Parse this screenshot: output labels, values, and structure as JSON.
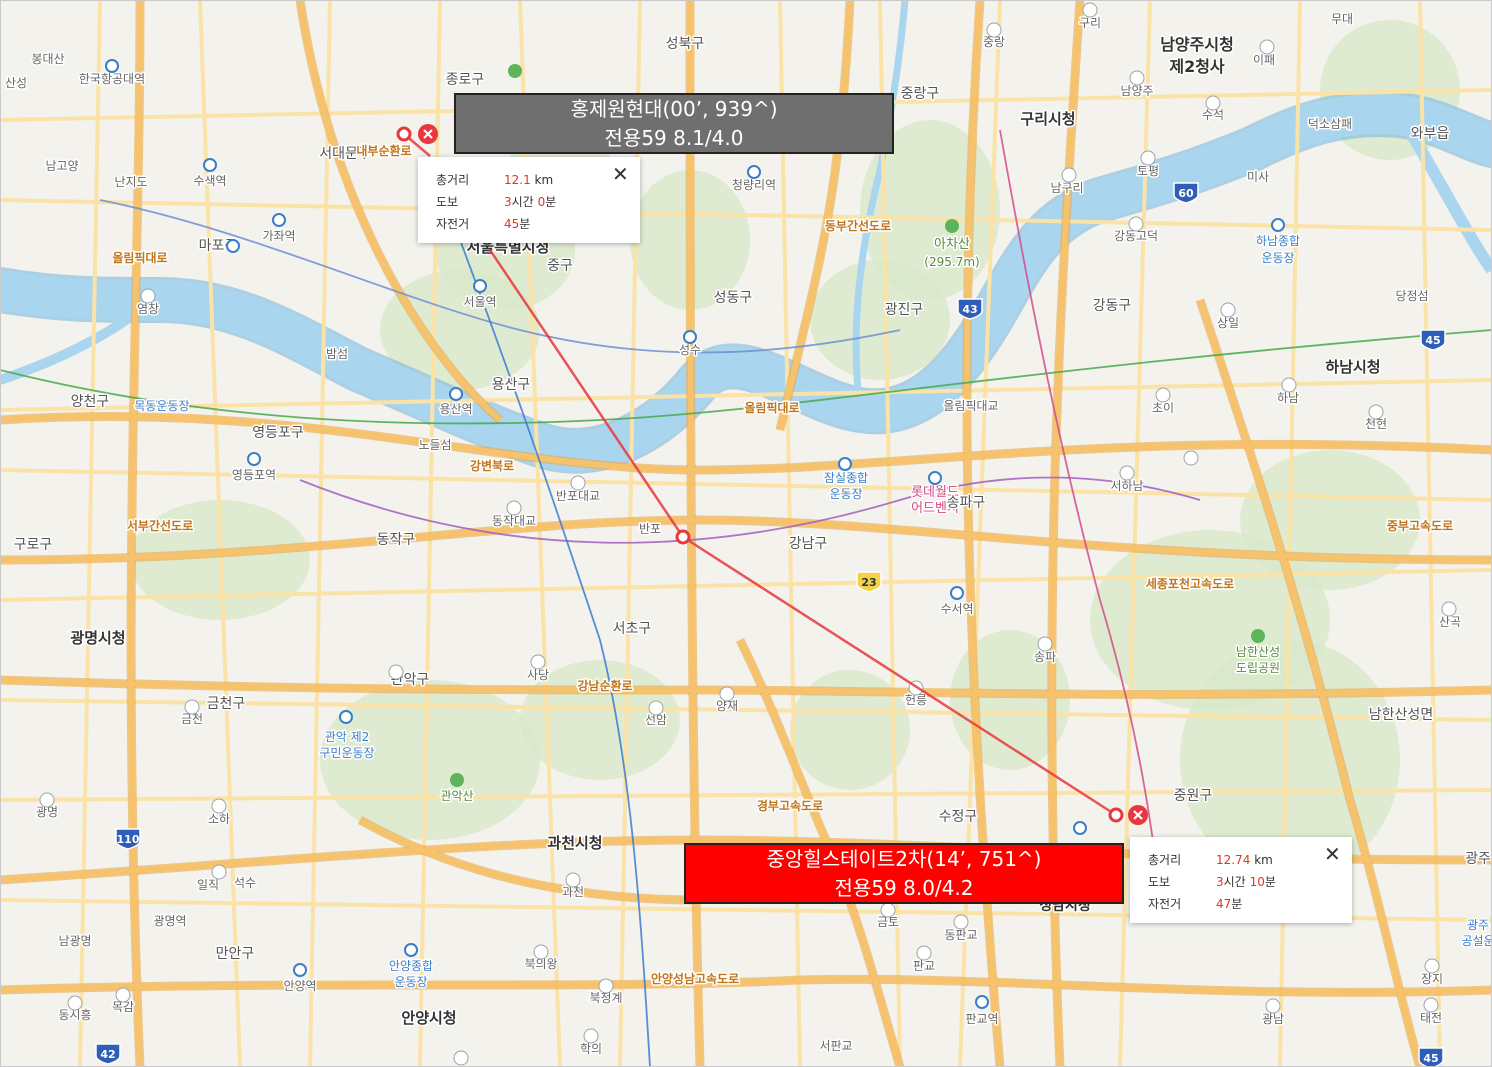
{
  "colors": {
    "land": "#f3f2ec",
    "river": "#a9d5ef",
    "river_edge": "#7fb8de",
    "park": "#d8e8c8",
    "road_main": "#f6c26b",
    "road_minor": "#fbe3a7",
    "measure_line": "#e8383d",
    "box_gray": "#6f6f6f",
    "box_red": "#ff0000"
  },
  "measurements": [
    {
      "title_line1": "홍제원현대(00’, 939^)",
      "title_line2": "전용59 8.1/4.0",
      "box_style": "gray",
      "total_label": "총거리",
      "total_value": "12.1",
      "total_unit": "km",
      "walk_label": "도보",
      "walk_h": "3",
      "walk_h_unit": "시간",
      "walk_m": "0",
      "walk_m_unit": "분",
      "bike_label": "자전거",
      "bike_m": "45",
      "bike_m_unit": "분"
    },
    {
      "title_line1": "중앙힐스테이트2차(14’, 751^)",
      "title_line2": "전용59 8.0/4.2",
      "box_style": "red",
      "total_label": "총거리",
      "total_value": "12.74",
      "total_unit": "km",
      "walk_label": "도보",
      "walk_h": "3",
      "walk_h_unit": "시간",
      "walk_m": "10",
      "walk_m_unit": "분",
      "bike_label": "자전거",
      "bike_m": "47",
      "bike_m_unit": "분"
    }
  ],
  "map_labels": [
    {
      "text": "성북구",
      "cls": "district"
    },
    {
      "text": "종로구",
      "cls": "district"
    },
    {
      "text": "서대문구",
      "cls": "district"
    },
    {
      "text": "중랑구",
      "cls": "district"
    },
    {
      "text": "구리시청",
      "cls": "city"
    },
    {
      "text": "남양주시청",
      "cls": "city"
    },
    {
      "text": "제2청사",
      "cls": "city"
    },
    {
      "text": "와부읍",
      "cls": "district"
    },
    {
      "text": "덕소삼패",
      "cls": "small"
    },
    {
      "text": "이패",
      "cls": "small"
    },
    {
      "text": "무대",
      "cls": "small"
    },
    {
      "text": "남구리",
      "cls": "small"
    },
    {
      "text": "토평",
      "cls": "small"
    },
    {
      "text": "미사",
      "cls": "small"
    },
    {
      "text": "수석",
      "cls": "small"
    },
    {
      "text": "남양주",
      "cls": "small"
    },
    {
      "text": "구리",
      "cls": "small"
    },
    {
      "text": "중랑",
      "cls": "small"
    },
    {
      "text": "강동고덕",
      "cls": "small"
    },
    {
      "text": "하남종합",
      "cls": "poi"
    },
    {
      "text": "운동장",
      "cls": "poi"
    },
    {
      "text": "당정섬",
      "cls": "small"
    },
    {
      "text": "하남시청",
      "cls": "city"
    },
    {
      "text": "강동구",
      "cls": "district"
    },
    {
      "text": "상일",
      "cls": "small"
    },
    {
      "text": "초이",
      "cls": "small"
    },
    {
      "text": "하남",
      "cls": "small"
    },
    {
      "text": "천현",
      "cls": "small"
    },
    {
      "text": "서하남",
      "cls": "small"
    },
    {
      "text": "아차산",
      "cls": "park"
    },
    {
      "text": "(295.7m)",
      "cls": "park"
    },
    {
      "text": "광진구",
      "cls": "district"
    },
    {
      "text": "청량리역",
      "cls": "small"
    },
    {
      "text": "한국항공대역",
      "cls": "small"
    },
    {
      "text": "봉대산",
      "cls": "small"
    },
    {
      "text": "산성",
      "cls": "small"
    },
    {
      "text": "남고양",
      "cls": "small"
    },
    {
      "text": "난지도",
      "cls": "small"
    },
    {
      "text": "수색역",
      "cls": "small"
    },
    {
      "text": "가좌역",
      "cls": "small"
    },
    {
      "text": "마포구",
      "cls": "district"
    },
    {
      "text": "염창",
      "cls": "small"
    },
    {
      "text": "밤섬",
      "cls": "small"
    },
    {
      "text": "서울역",
      "cls": "small"
    },
    {
      "text": "서울특별시청",
      "cls": "city"
    },
    {
      "text": "중구",
      "cls": "district"
    },
    {
      "text": "성동구",
      "cls": "district"
    },
    {
      "text": "성수",
      "cls": "small"
    },
    {
      "text": "용산구",
      "cls": "district"
    },
    {
      "text": "용산역",
      "cls": "small"
    },
    {
      "text": "노들섬",
      "cls": "small"
    },
    {
      "text": "강변북로",
      "cls": "road"
    },
    {
      "text": "올림픽대로",
      "cls": "road"
    },
    {
      "text": "올림픽대교",
      "cls": "small"
    },
    {
      "text": "잠실종합",
      "cls": "poi"
    },
    {
      "text": "운동장",
      "cls": "poi"
    },
    {
      "text": "롯데월드",
      "cls": "poi2"
    },
    {
      "text": "어드벤처",
      "cls": "poi2"
    },
    {
      "text": "송파구",
      "cls": "district"
    },
    {
      "text": "양천구",
      "cls": "district"
    },
    {
      "text": "목동운동장",
      "cls": "poi"
    },
    {
      "text": "영등포구",
      "cls": "district"
    },
    {
      "text": "영등포역",
      "cls": "small"
    },
    {
      "text": "반포대교",
      "cls": "small"
    },
    {
      "text": "동작대교",
      "cls": "small"
    },
    {
      "text": "반포",
      "cls": "small"
    },
    {
      "text": "강남구",
      "cls": "district"
    },
    {
      "text": "수서역",
      "cls": "small"
    },
    {
      "text": "구로구",
      "cls": "district"
    },
    {
      "text": "동작구",
      "cls": "district"
    },
    {
      "text": "서초구",
      "cls": "district"
    },
    {
      "text": "광명시청",
      "cls": "city"
    },
    {
      "text": "관악구",
      "cls": "district"
    },
    {
      "text": "사당",
      "cls": "small"
    },
    {
      "text": "강남순환로",
      "cls": "road"
    },
    {
      "text": "선암",
      "cls": "small"
    },
    {
      "text": "양재",
      "cls": "small"
    },
    {
      "text": "헌릉",
      "cls": "small"
    },
    {
      "text": "송파",
      "cls": "small"
    },
    {
      "text": "남한산성",
      "cls": "park"
    },
    {
      "text": "도립공원",
      "cls": "park"
    },
    {
      "text": "남한산성면",
      "cls": "district"
    },
    {
      "text": "금천구",
      "cls": "district"
    },
    {
      "text": "금천",
      "cls": "small"
    },
    {
      "text": "관악 제2",
      "cls": "poi"
    },
    {
      "text": "구민운동장",
      "cls": "poi"
    },
    {
      "text": "관악산",
      "cls": "park"
    },
    {
      "text": "수정구",
      "cls": "district"
    },
    {
      "text": "중원구",
      "cls": "district"
    },
    {
      "text": "광명",
      "cls": "small"
    },
    {
      "text": "소하",
      "cls": "small"
    },
    {
      "text": "과천시청",
      "cls": "city"
    },
    {
      "text": "과천",
      "cls": "small"
    },
    {
      "text": "일직",
      "cls": "small"
    },
    {
      "text": "석수",
      "cls": "small"
    },
    {
      "text": "광명역",
      "cls": "small"
    },
    {
      "text": "남광명",
      "cls": "small"
    },
    {
      "text": "만안구",
      "cls": "district"
    },
    {
      "text": "안양종합",
      "cls": "poi"
    },
    {
      "text": "운동장",
      "cls": "poi"
    },
    {
      "text": "안양역",
      "cls": "small"
    },
    {
      "text": "안양시청",
      "cls": "city"
    },
    {
      "text": "북의왕",
      "cls": "small"
    },
    {
      "text": "북청계",
      "cls": "small"
    },
    {
      "text": "학의",
      "cls": "small"
    },
    {
      "text": "동시흥",
      "cls": "small"
    },
    {
      "text": "목감",
      "cls": "small"
    },
    {
      "text": "금토",
      "cls": "small"
    },
    {
      "text": "판교",
      "cls": "small"
    },
    {
      "text": "동판교",
      "cls": "small"
    },
    {
      "text": "판교역",
      "cls": "small"
    },
    {
      "text": "서판교",
      "cls": "small"
    },
    {
      "text": "성남시청",
      "cls": "city"
    },
    {
      "text": "광주",
      "cls": "district"
    },
    {
      "text": "광주",
      "cls": "poi"
    },
    {
      "text": "공설운",
      "cls": "poi"
    },
    {
      "text": "장지",
      "cls": "small"
    },
    {
      "text": "태전",
      "cls": "small"
    },
    {
      "text": "광남",
      "cls": "small"
    },
    {
      "text": "산곡",
      "cls": "small"
    },
    {
      "text": "안양성남고속도로",
      "cls": "road"
    },
    {
      "text": "세종포천고속도로",
      "cls": "road"
    },
    {
      "text": "동부간선도로",
      "cls": "road"
    },
    {
      "text": "내부순환로",
      "cls": "road"
    },
    {
      "text": "서부간선도로",
      "cls": "road"
    },
    {
      "text": "경부고속도로",
      "cls": "road"
    },
    {
      "text": "중부고속도로",
      "cls": "road"
    },
    {
      "text": "올림픽대로",
      "cls": "road"
    }
  ],
  "route_shields": [
    "60",
    "43",
    "45",
    "45",
    "23",
    "110",
    "42"
  ]
}
